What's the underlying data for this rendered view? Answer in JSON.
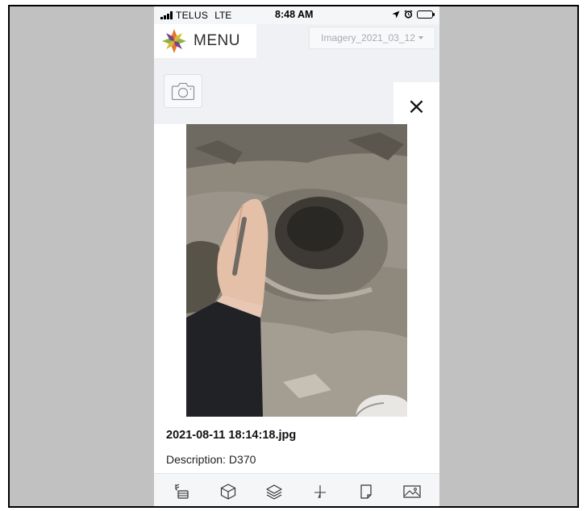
{
  "status_bar": {
    "carrier": "TELUS",
    "network": "LTE",
    "time": "8:48 AM"
  },
  "header": {
    "menu_label": "MENU",
    "imagery_selected": "Imagery_2021_03_12"
  },
  "modal": {
    "close_glyph": "×",
    "photo_caption": "2021-08-11 18:14:18.jpg",
    "description_label": "Description:",
    "description_value": "D370"
  },
  "bottom_toolbar": {
    "tools": [
      "soil-sampling-icon",
      "cube-icon",
      "layers-icon",
      "crosshair-icon",
      "note-icon",
      "image-icon"
    ]
  },
  "colors": {
    "backdrop": "#c1c1c1",
    "app_background": "#eff1f4",
    "placeholder_text": "#a7abb1",
    "logo_orange": "#e0772b",
    "logo_green": "#8db53c",
    "logo_purple": "#7a3f8f",
    "logo_yellow": "#d9b632"
  }
}
